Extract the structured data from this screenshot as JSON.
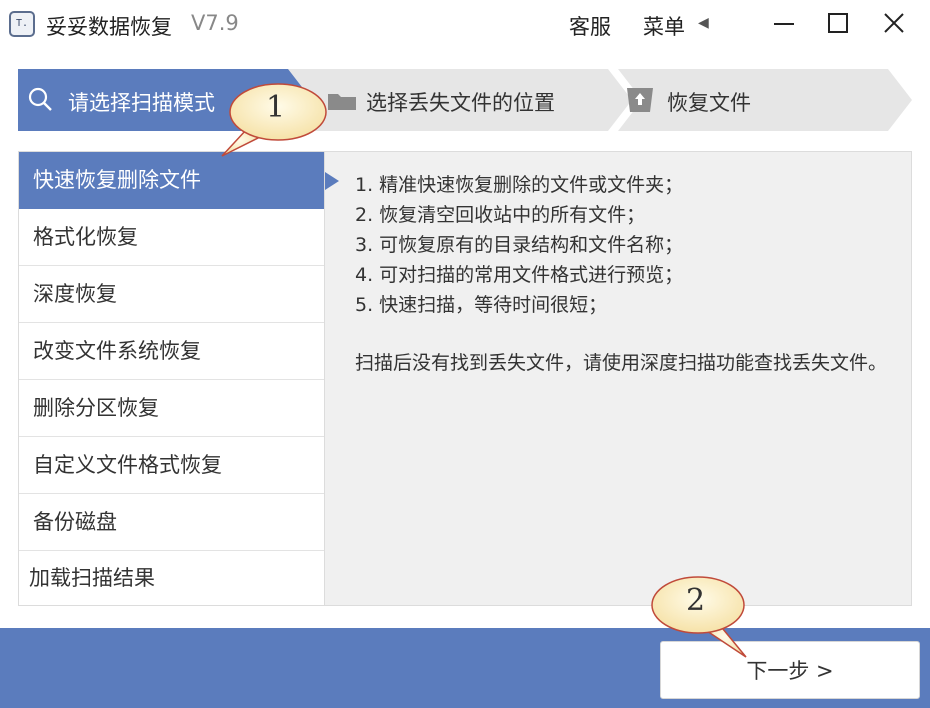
{
  "window": {
    "title": "妥妥数据恢复",
    "version": "V7.9",
    "logo_text": "T.",
    "service_label": "客服",
    "menu_label": "菜单",
    "menu_arrow": "◀"
  },
  "steps": [
    {
      "label": "请选择扫描模式",
      "icon": "search-icon",
      "active": true
    },
    {
      "label": "选择丢失文件的位置",
      "icon": "folder-icon",
      "active": false
    },
    {
      "label": "恢复文件",
      "icon": "recover-icon",
      "active": false
    }
  ],
  "modes": [
    {
      "label": "快速恢复删除文件",
      "selected": true
    },
    {
      "label": "格式化恢复",
      "selected": false
    },
    {
      "label": "深度恢复",
      "selected": false
    },
    {
      "label": "改变文件系统恢复",
      "selected": false
    },
    {
      "label": "删除分区恢复",
      "selected": false
    },
    {
      "label": "自定义文件格式恢复",
      "selected": false
    },
    {
      "label": "备份磁盘",
      "selected": false
    },
    {
      "label": "加载扫描结果",
      "selected": false
    }
  ],
  "description": {
    "lines": [
      "1. 精准快速恢复删除的文件或文件夹；",
      "2. 恢复清空回收站中的所有文件；",
      "3. 可恢复原有的目录结构和文件名称；",
      "4. 可对扫描的常用文件格式进行预览；",
      "5. 快速扫描，等待时间很短；"
    ],
    "note": "扫描后没有找到丢失文件，请使用深度扫描功能查找丢失文件。"
  },
  "next_button": {
    "label": "下一步 >"
  },
  "annotations": [
    {
      "number": "1"
    },
    {
      "number": "2"
    }
  ],
  "colors": {
    "accent": "#5b7cbd",
    "step_inactive": "#e6e6e6",
    "panel_bg": "#f0f0f0",
    "bubble_fill": "#fdf2d0",
    "bubble_stroke": "#c04a3a"
  }
}
